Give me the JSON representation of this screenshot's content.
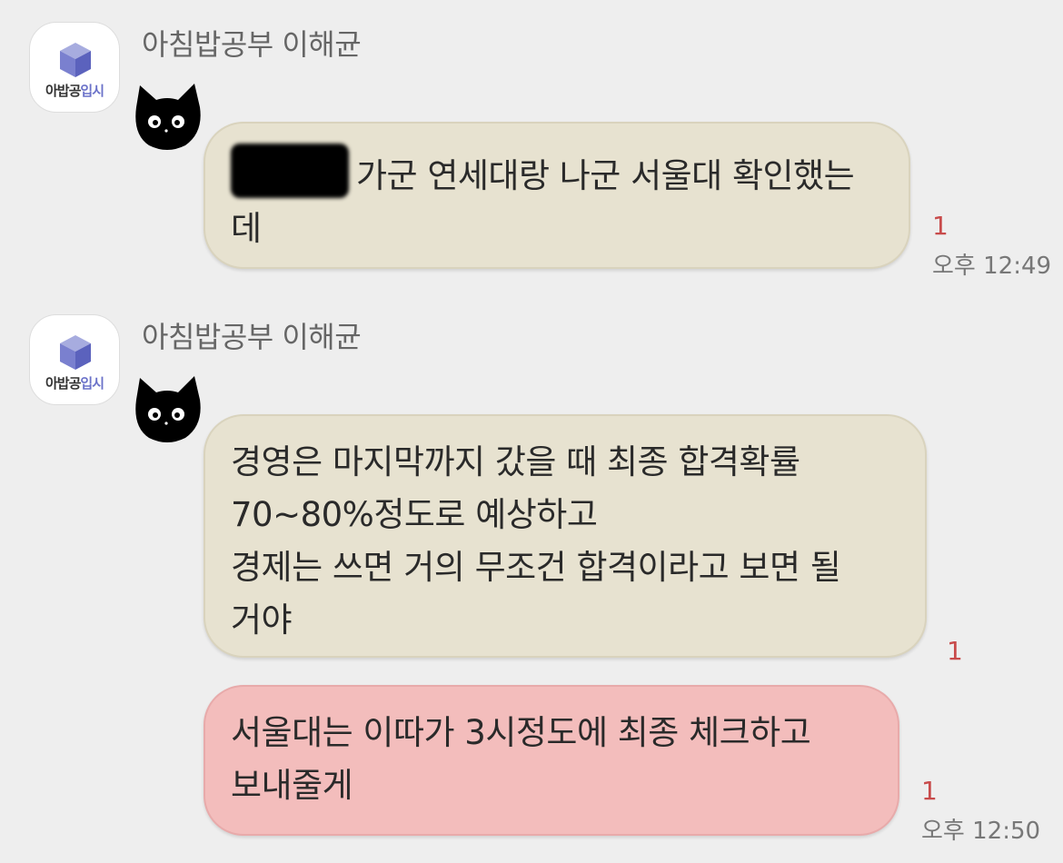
{
  "chat": {
    "messages": [
      {
        "sender": "아침밥공부 이해균",
        "avatar_text_main": "아밥공",
        "avatar_text_accent": "입시",
        "lines": [
          "가군 연세대랑 나군 서울대 확인했는",
          "데"
        ],
        "unread": "1",
        "time": "오후 12:49",
        "has_redaction": true
      },
      {
        "sender": "아침밥공부 이해균",
        "avatar_text_main": "아밥공",
        "avatar_text_accent": "입시",
        "lines": [
          "경영은 마지막까지 갔을 때 최종 합격확률",
          "70~80%정도로 예상하고",
          "경제는 쓰면 거의 무조건 합격이라고 보면 될",
          "거야"
        ],
        "unread": "1"
      },
      {
        "lines": [
          "서울대는 이따가 3시정도에 최종 체크하고",
          "보내줄게"
        ],
        "unread": "1",
        "time": "오후 12:50"
      }
    ]
  },
  "colors": {
    "background": "#eeeeee",
    "bubble_beige": "#e7e2d0",
    "bubble_pink": "#f3bdbc",
    "unread": "#c84b4b",
    "logo_accent": "#6b72c9"
  },
  "icons": {
    "avatar": "cube-logo-icon",
    "sticker": "black-cat-icon"
  }
}
